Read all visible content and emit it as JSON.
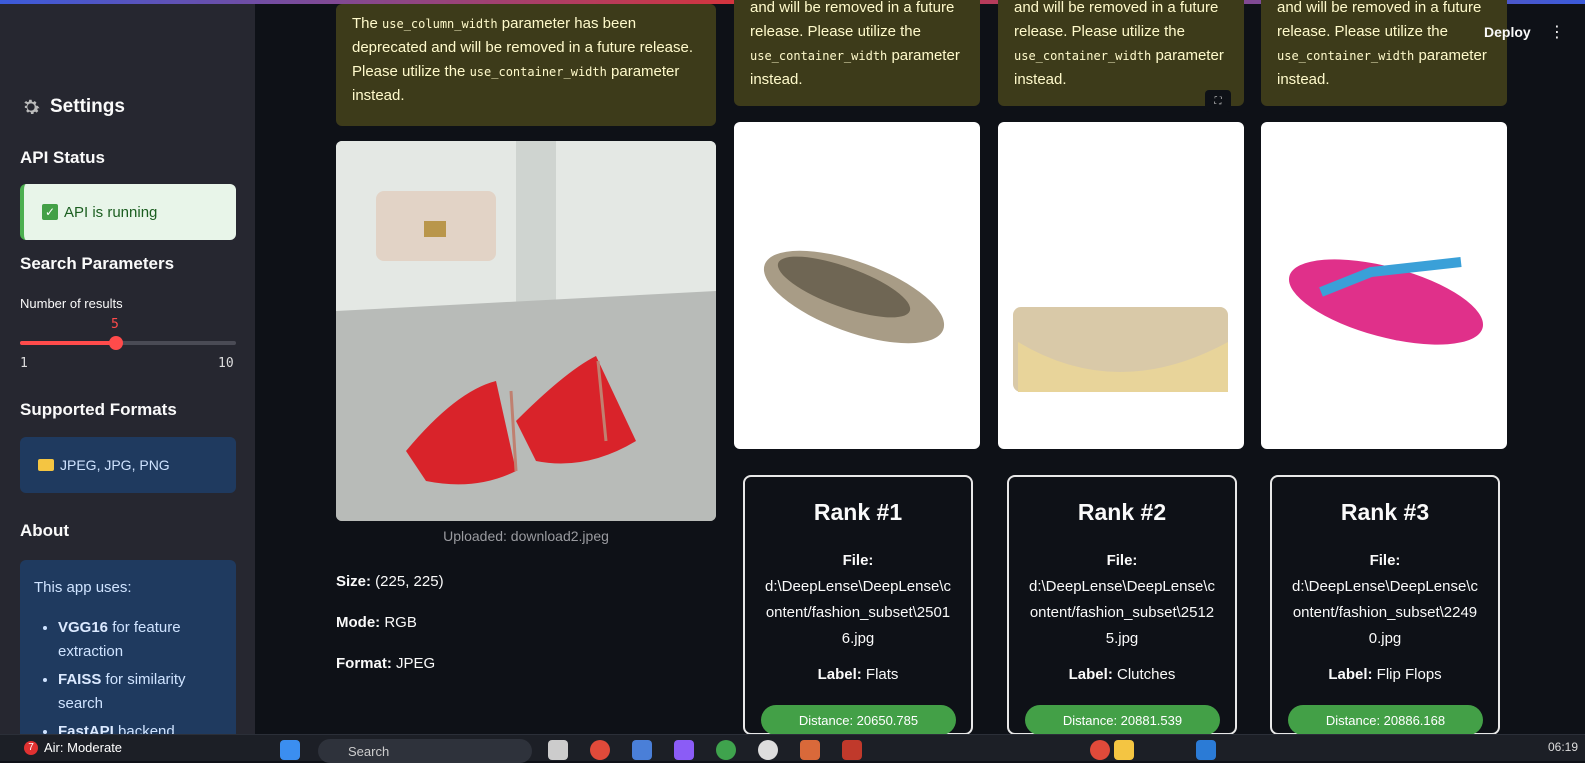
{
  "header": {
    "deploy_label": "Deploy",
    "menu_icon": "kebab-menu-icon"
  },
  "sidebar": {
    "title": "Settings",
    "title_icon": "gear-icon",
    "api_status_heading": "API Status",
    "api_status_text": "API is running",
    "search_params_heading": "Search Parameters",
    "slider": {
      "label": "Number of results",
      "value": "5",
      "min": "1",
      "max": "10",
      "fraction": 0.444
    },
    "formats_heading": "Supported Formats",
    "formats_text": "JPEG, JPG, PNG",
    "about_heading": "About",
    "about_intro": "This app uses:",
    "about_items": [
      {
        "bold": "VGG16",
        "text": " for feature extraction"
      },
      {
        "bold": "FAISS",
        "text": " for similarity search"
      },
      {
        "bold": "FastAPI",
        "text": " backend"
      }
    ]
  },
  "warnings": {
    "first": {
      "pre": "The ",
      "code1": "use_column_width",
      "mid": " parameter has been deprecated and will be removed in a future release. Please utilize the ",
      "code2": "use_container_width",
      "post": " parameter instead."
    },
    "partial_line1": "and will be removed in a future",
    "partial_line2": "release. Please utilize the",
    "partial_code": "use_container_width",
    "partial_post": " parameter",
    "partial_line4": "instead."
  },
  "upload": {
    "caption": "Uploaded: download2.jpeg",
    "size_label": "Size:",
    "size_value": " (225, 225)",
    "mode_label": "Mode:",
    "mode_value": " RGB",
    "format_label": "Format:",
    "format_value": " JPEG"
  },
  "results": [
    {
      "rank": "Rank #1",
      "file_label": "File:",
      "file": "d:\\DeepLense\\DeepLense\\content/fashion_subset\\25016.jpg",
      "label_key": "Label:",
      "label": " Flats",
      "distance": "Distance: 20650.785"
    },
    {
      "rank": "Rank #2",
      "file_label": "File:",
      "file": "d:\\DeepLense\\DeepLense\\content/fashion_subset\\25125.jpg",
      "label_key": "Label:",
      "label": " Clutches",
      "distance": "Distance: 20881.539"
    },
    {
      "rank": "Rank #3",
      "file_label": "File:",
      "file": "d:\\DeepLense\\DeepLense\\content/fashion_subset\\22490.jpg",
      "label_key": "Label:",
      "label": " Flip Flops",
      "distance": "Distance: 20886.168"
    }
  ],
  "taskbar": {
    "air_badge": "7",
    "air_text": "Air: Moderate",
    "search_placeholder": "Search",
    "clock": "06:19"
  }
}
